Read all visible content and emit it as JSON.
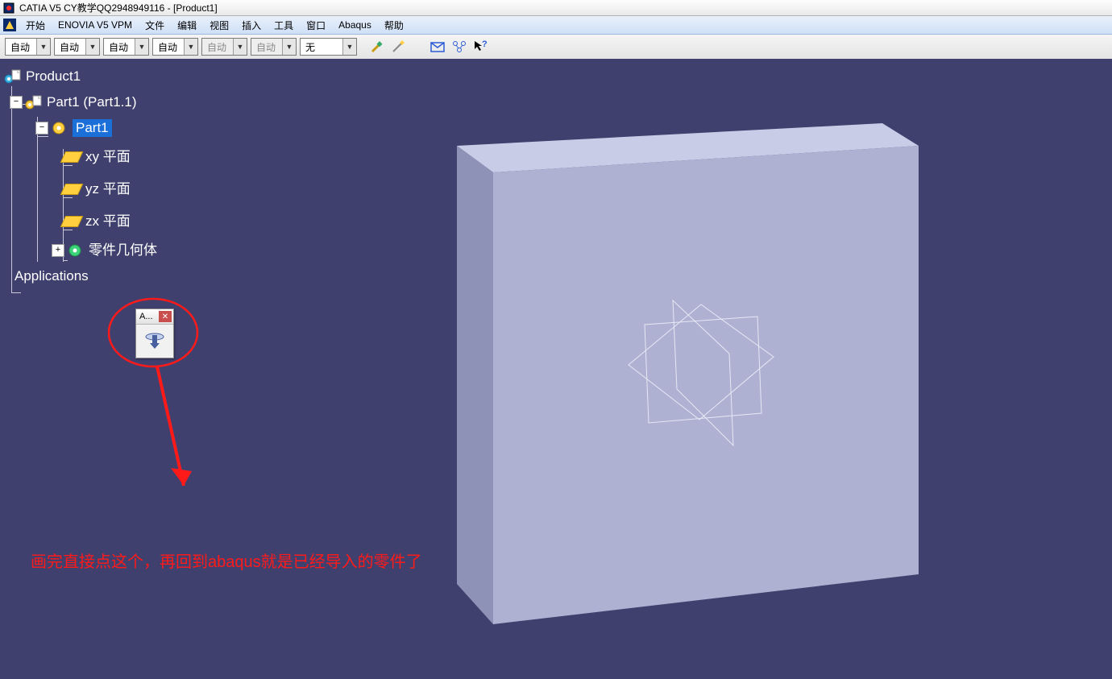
{
  "titlebar": {
    "text": "CATIA V5   CY教学QQ2948949116 - [Product1]"
  },
  "menu": {
    "items": [
      "开始",
      "ENOVIA V5 VPM",
      "文件",
      "编辑",
      "视图",
      "插入",
      "工具",
      "窗口",
      "Abaqus",
      "帮助"
    ]
  },
  "toolbar": {
    "combos": [
      {
        "label": "自动",
        "disabled": false
      },
      {
        "label": "自动",
        "disabled": false
      },
      {
        "label": "自动",
        "disabled": false
      },
      {
        "label": "自动",
        "disabled": false
      },
      {
        "label": "自动",
        "disabled": true
      },
      {
        "label": "自动",
        "disabled": true
      },
      {
        "label": "无",
        "disabled": false
      }
    ]
  },
  "tree": {
    "root": "Product1",
    "part_instance": "Part1 (Part1.1)",
    "part": "Part1",
    "planes": [
      "xy 平面",
      "yz 平面",
      "zx 平面"
    ],
    "body": "零件几何体",
    "apps": "Applications"
  },
  "floating": {
    "title": "A..."
  },
  "annotation": "画完直接点这个，再回到abaqus就是已经导入的零件了"
}
